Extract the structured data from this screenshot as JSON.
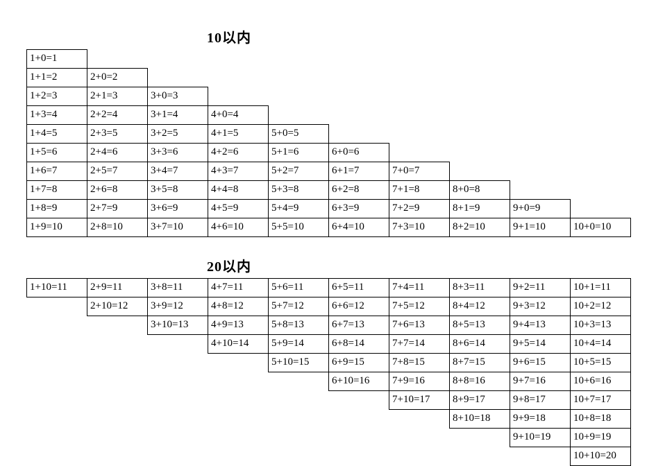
{
  "title10": "10以内",
  "title20": "20以内",
  "table10": [
    [
      "1+0=1"
    ],
    [
      "1+1=2",
      "2+0=2"
    ],
    [
      "1+2=3",
      "2+1=3",
      "3+0=3"
    ],
    [
      "1+3=4",
      "2+2=4",
      "3+1=4",
      "4+0=4"
    ],
    [
      "1+4=5",
      "2+3=5",
      "3+2=5",
      "4+1=5",
      "5+0=5"
    ],
    [
      "1+5=6",
      "2+4=6",
      "3+3=6",
      "4+2=6",
      "5+1=6",
      "6+0=6"
    ],
    [
      "1+6=7",
      "2+5=7",
      "3+4=7",
      "4+3=7",
      "5+2=7",
      "6+1=7",
      "7+0=7"
    ],
    [
      "1+7=8",
      "2+6=8",
      "3+5=8",
      "4+4=8",
      "5+3=8",
      "6+2=8",
      "7+1=8",
      "8+0=8"
    ],
    [
      "1+8=9",
      "2+7=9",
      "3+6=9",
      "4+5=9",
      "5+4=9",
      "6+3=9",
      "7+2=9",
      "8+1=9",
      "9+0=9"
    ],
    [
      "1+9=10",
      "2+8=10",
      "3+7=10",
      "4+6=10",
      "5+5=10",
      "6+4=10",
      "7+3=10",
      "8+2=10",
      "9+1=10",
      "10+0=10"
    ]
  ],
  "table20": [
    [
      "1+10=11",
      "2+9=11",
      "3+8=11",
      "4+7=11",
      "5+6=11",
      "6+5=11",
      "7+4=11",
      "8+3=11",
      "9+2=11",
      "10+1=11"
    ],
    [
      "",
      "2+10=12",
      "3+9=12",
      "4+8=12",
      "5+7=12",
      "6+6=12",
      "7+5=12",
      "8+4=12",
      "9+3=12",
      "10+2=12"
    ],
    [
      "",
      "",
      "3+10=13",
      "4+9=13",
      "5+8=13",
      "6+7=13",
      "7+6=13",
      "8+5=13",
      "9+4=13",
      "10+3=13"
    ],
    [
      "",
      "",
      "",
      "4+10=14",
      "5+9=14",
      "6+8=14",
      "7+7=14",
      "8+6=14",
      "9+5=14",
      "10+4=14"
    ],
    [
      "",
      "",
      "",
      "",
      "5+10=15",
      "6+9=15",
      "7+8=15",
      "8+7=15",
      "9+6=15",
      "10+5=15"
    ],
    [
      "",
      "",
      "",
      "",
      "",
      "6+10=16",
      "7+9=16",
      "8+8=16",
      "9+7=16",
      "10+6=16"
    ],
    [
      "",
      "",
      "",
      "",
      "",
      "",
      "7+10=17",
      "8+9=17",
      "9+8=17",
      "10+7=17"
    ],
    [
      "",
      "",
      "",
      "",
      "",
      "",
      "",
      "8+10=18",
      "9+9=18",
      "10+8=18"
    ],
    [
      "",
      "",
      "",
      "",
      "",
      "",
      "",
      "",
      "9+10=19",
      "10+9=19"
    ],
    [
      "",
      "",
      "",
      "",
      "",
      "",
      "",
      "",
      "",
      "10+10=20"
    ]
  ],
  "chart_data": [
    {
      "type": "table",
      "title": "10以内",
      "columns": 10,
      "rows": [
        [
          "1+0=1"
        ],
        [
          "1+1=2",
          "2+0=2"
        ],
        [
          "1+2=3",
          "2+1=3",
          "3+0=3"
        ],
        [
          "1+3=4",
          "2+2=4",
          "3+1=4",
          "4+0=4"
        ],
        [
          "1+4=5",
          "2+3=5",
          "3+2=5",
          "4+1=5",
          "5+0=5"
        ],
        [
          "1+5=6",
          "2+4=6",
          "3+3=6",
          "4+2=6",
          "5+1=6",
          "6+0=6"
        ],
        [
          "1+6=7",
          "2+5=7",
          "3+4=7",
          "4+3=7",
          "5+2=7",
          "6+1=7",
          "7+0=7"
        ],
        [
          "1+7=8",
          "2+6=8",
          "3+5=8",
          "4+4=8",
          "5+3=8",
          "6+2=8",
          "7+1=8",
          "8+0=8"
        ],
        [
          "1+8=9",
          "2+7=9",
          "3+6=9",
          "4+5=9",
          "5+4=9",
          "6+3=9",
          "7+2=9",
          "8+1=9",
          "9+0=9"
        ],
        [
          "1+9=10",
          "2+8=10",
          "3+7=10",
          "4+6=10",
          "5+5=10",
          "6+4=10",
          "7+3=10",
          "8+2=10",
          "9+1=10",
          "10+0=10"
        ]
      ]
    },
    {
      "type": "table",
      "title": "20以内",
      "columns": 10,
      "rows": [
        [
          "1+10=11",
          "2+9=11",
          "3+8=11",
          "4+7=11",
          "5+6=11",
          "6+5=11",
          "7+4=11",
          "8+3=11",
          "9+2=11",
          "10+1=11"
        ],
        [
          "",
          "2+10=12",
          "3+9=12",
          "4+8=12",
          "5+7=12",
          "6+6=12",
          "7+5=12",
          "8+4=12",
          "9+3=12",
          "10+2=12"
        ],
        [
          "",
          "",
          "3+10=13",
          "4+9=13",
          "5+8=13",
          "6+7=13",
          "7+6=13",
          "8+5=13",
          "9+4=13",
          "10+3=13"
        ],
        [
          "",
          "",
          "",
          "4+10=14",
          "5+9=14",
          "6+8=14",
          "7+7=14",
          "8+6=14",
          "9+5=14",
          "10+4=14"
        ],
        [
          "",
          "",
          "",
          "",
          "5+10=15",
          "6+9=15",
          "7+8=15",
          "8+7=15",
          "9+6=15",
          "10+5=15"
        ],
        [
          "",
          "",
          "",
          "",
          "",
          "6+10=16",
          "7+9=16",
          "8+8=16",
          "9+7=16",
          "10+6=16"
        ],
        [
          "",
          "",
          "",
          "",
          "",
          "",
          "7+10=17",
          "8+9=17",
          "9+8=17",
          "10+7=17"
        ],
        [
          "",
          "",
          "",
          "",
          "",
          "",
          "",
          "8+10=18",
          "9+9=18",
          "10+8=18"
        ],
        [
          "",
          "",
          "",
          "",
          "",
          "",
          "",
          "",
          "9+10=19",
          "10+9=19"
        ],
        [
          "",
          "",
          "",
          "",
          "",
          "",
          "",
          "",
          "",
          "10+10=20"
        ]
      ]
    }
  ]
}
